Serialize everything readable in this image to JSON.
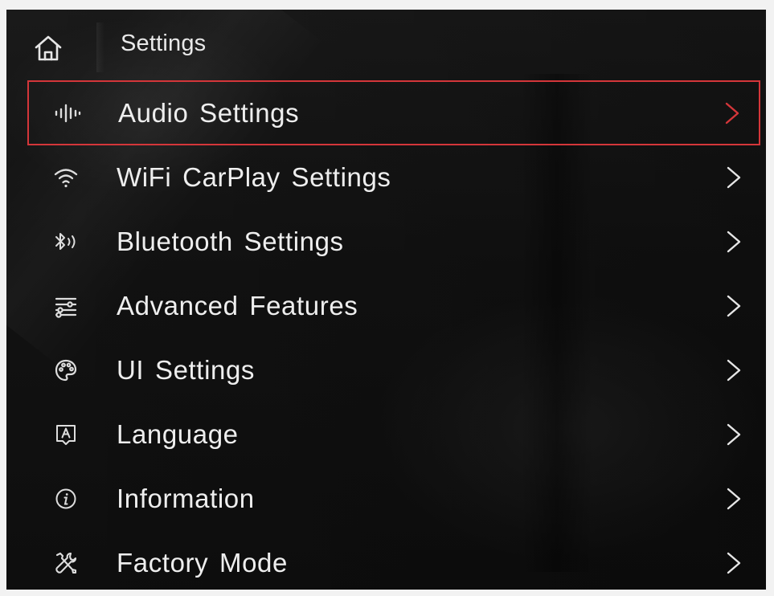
{
  "header": {
    "title": "Settings",
    "home_icon": "home-icon"
  },
  "menu": {
    "selected_index": 0,
    "accent_color": "#d4363a",
    "items": [
      {
        "label": "Audio Settings",
        "icon": "equalizer-icon"
      },
      {
        "label": "WiFi CarPlay Settings",
        "icon": "wifi-icon"
      },
      {
        "label": "Bluetooth Settings",
        "icon": "bluetooth-icon"
      },
      {
        "label": "Advanced Features",
        "icon": "sliders-icon"
      },
      {
        "label": "UI Settings",
        "icon": "palette-icon"
      },
      {
        "label": "Language",
        "icon": "language-icon"
      },
      {
        "label": "Information",
        "icon": "info-icon"
      },
      {
        "label": "Factory Mode",
        "icon": "tools-icon"
      }
    ]
  }
}
